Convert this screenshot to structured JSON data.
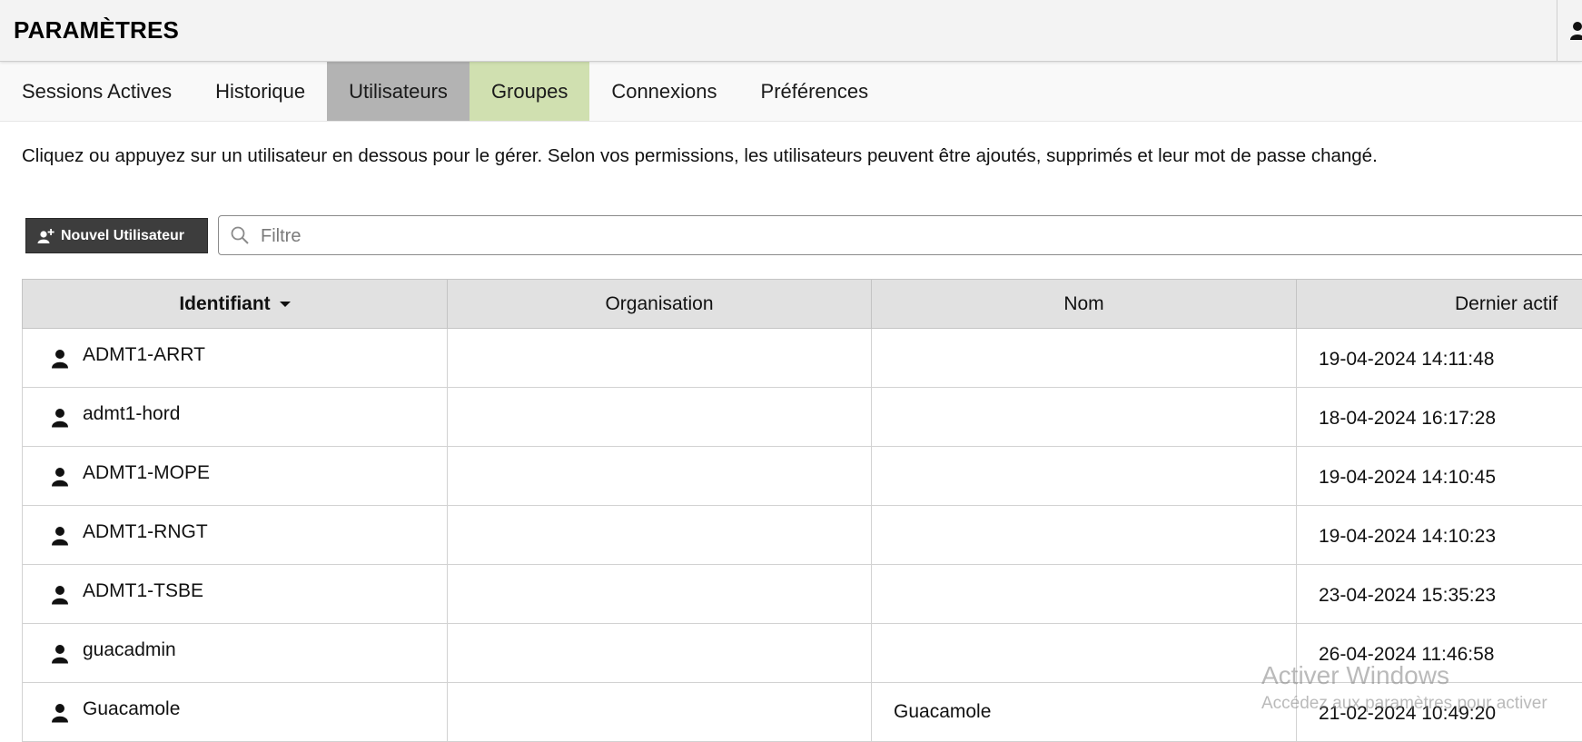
{
  "header": {
    "title": "PARAMÈTRES"
  },
  "tabs": [
    {
      "label": "Sessions Actives",
      "state": "normal"
    },
    {
      "label": "Historique",
      "state": "normal"
    },
    {
      "label": "Utilisateurs",
      "state": "active"
    },
    {
      "label": "Groupes",
      "state": "hover"
    },
    {
      "label": "Connexions",
      "state": "normal"
    },
    {
      "label": "Préférences",
      "state": "normal"
    }
  ],
  "description": "Cliquez ou appuyez sur un utilisateur en dessous pour le gérer. Selon vos permissions, les utilisateurs peuvent être ajoutés, supprimés et leur mot de passe changé.",
  "toolbar": {
    "new_user_label": "Nouvel Utilisateur",
    "new_user_icon": "add-user-icon",
    "filter_placeholder": "Filtre",
    "filter_value": "",
    "filter_icon": "search-icon"
  },
  "table": {
    "columns": [
      "Identifiant",
      "Organisation",
      "Nom",
      "Dernier actif"
    ],
    "sorted_column": "Identifiant",
    "sort_direction": "desc-arrow",
    "row_icon": "person-icon",
    "rows": [
      {
        "identifiant": "ADMT1-ARRT",
        "organisation": "",
        "nom": "",
        "dernier_actif": "19-04-2024 14:11:48"
      },
      {
        "identifiant": "admt1-hord",
        "organisation": "",
        "nom": "",
        "dernier_actif": "18-04-2024 16:17:28"
      },
      {
        "identifiant": "ADMT1-MOPE",
        "organisation": "",
        "nom": "",
        "dernier_actif": "19-04-2024 14:10:45"
      },
      {
        "identifiant": "ADMT1-RNGT",
        "organisation": "",
        "nom": "",
        "dernier_actif": "19-04-2024 14:10:23"
      },
      {
        "identifiant": "ADMT1-TSBE",
        "organisation": "",
        "nom": "",
        "dernier_actif": "23-04-2024 15:35:23"
      },
      {
        "identifiant": "guacadmin",
        "organisation": "",
        "nom": "",
        "dernier_actif": "26-04-2024 11:46:58"
      },
      {
        "identifiant": "Guacamole",
        "organisation": "",
        "nom": "Guacamole",
        "dernier_actif": "21-02-2024 10:49:20"
      }
    ]
  },
  "watermark": {
    "line1": "Activer Windows",
    "line2": "Accédez aux paramètres pour activer"
  },
  "colors": {
    "tab_active": "#b3b3b3",
    "tab_hover": "#d0e0b0",
    "header_bg": "#f3f3f3",
    "table_header_bg": "#e1e1e1",
    "button_bg": "#3d3d3d"
  }
}
